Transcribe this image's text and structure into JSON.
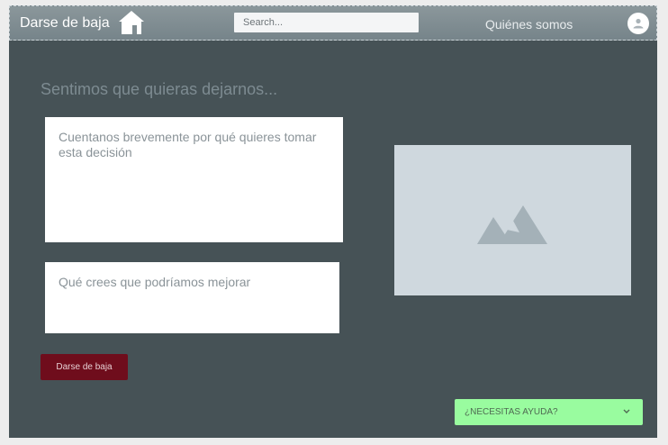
{
  "header": {
    "brand": "Darse de baja",
    "search_placeholder": "Search...",
    "nav_link": "Quiénes somos",
    "home_icon": "home-icon",
    "avatar_icon": "user-icon"
  },
  "main": {
    "heading": "Sentimos que quieras dejarnos...",
    "reason_placeholder": "Cuentanos brevemente por qué quieres tomar esta decisión",
    "improve_placeholder": "Qué crees que podríamos mejorar",
    "image_icon": "image-placeholder-icon",
    "submit_label": "Darse de baja"
  },
  "help": {
    "label": "¿NECESITAS AYUDA?",
    "icon": "chevron-down-icon"
  },
  "colors": {
    "header_bg": "#7f8c91",
    "page_bg": "#465256",
    "submit_bg": "#6f0d1c",
    "help_bg": "#99fc9f"
  }
}
